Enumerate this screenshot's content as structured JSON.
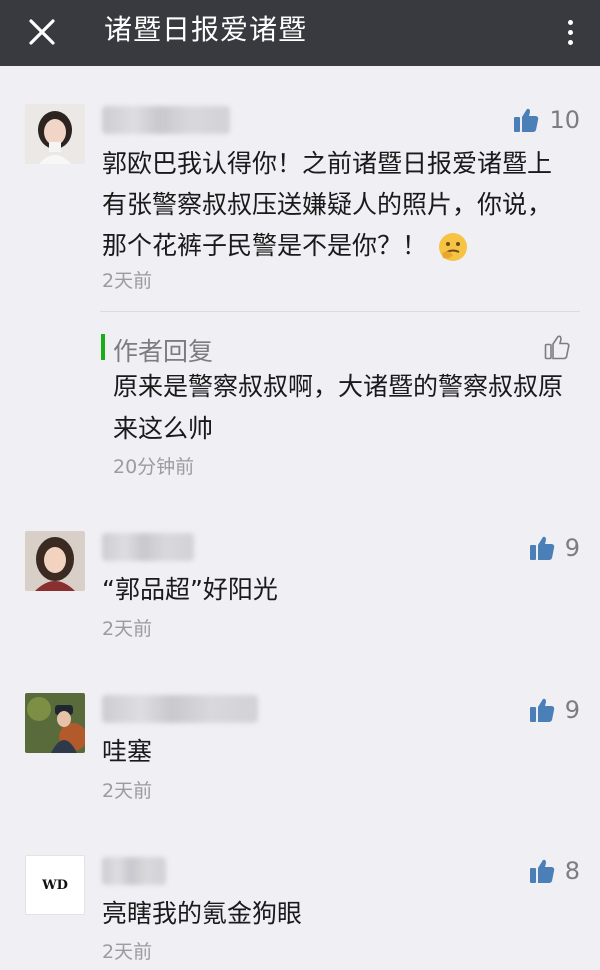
{
  "header": {
    "title": "诸暨日报爱诸暨",
    "close_icon": "close-icon",
    "more_icon": "more-vertical-icon"
  },
  "comments": [
    {
      "likes": "10",
      "text": "郭欧巴我认得你！之前诸暨日报爱诸暨上有张警察叔叔压送嫌疑人的照片，你说，那个花裤子民警是不是你？！",
      "emoji": "thinking-face-emoji",
      "time": "2天前",
      "reply": {
        "label": "作者回复",
        "text": "原来是警察叔叔啊，大诸暨的警察叔叔原来这么帅",
        "time": "20分钟前"
      }
    },
    {
      "likes": "9",
      "text": "“郭品超”好阳光",
      "time": "2天前"
    },
    {
      "likes": "9",
      "text": "哇塞",
      "time": "2天前"
    },
    {
      "likes": "8",
      "text": "亮瞎我的氪金狗眼",
      "time": "2天前",
      "avatar_text": "WD"
    }
  ],
  "colors": {
    "header_bg": "#393a3f",
    "page_bg": "#efeff4",
    "accent_green": "#1aad19",
    "like_blue": "#4b7fb8",
    "muted_text": "#9b9ba0"
  }
}
